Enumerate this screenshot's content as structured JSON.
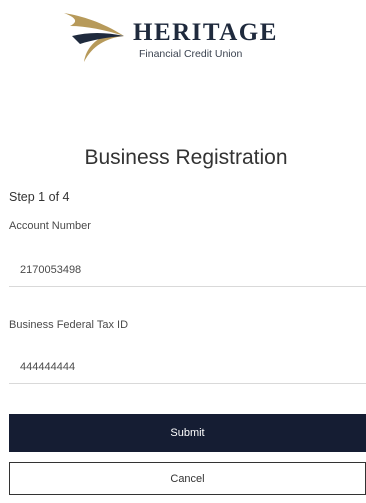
{
  "brand": {
    "name": "HERITAGE",
    "subtitle": "Financial Credit Union",
    "logo_icon": "heritage-swoosh-logo",
    "colors": {
      "navy": "#151d33",
      "gold": "#b79a5a"
    }
  },
  "form": {
    "title": "Business Registration",
    "step": "Step 1 of 4",
    "account_number": {
      "label": "Account Number",
      "value": "2170053498"
    },
    "tax_id": {
      "label": "Business Federal Tax ID",
      "value": "444444444"
    },
    "submit_label": "Submit",
    "cancel_label": "Cancel"
  }
}
